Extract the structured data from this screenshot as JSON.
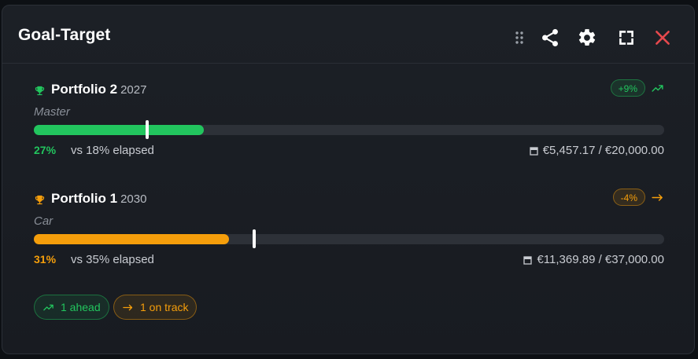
{
  "header": {
    "title": "Goal-Target",
    "icons": [
      "drag-handle-icon",
      "share-icon",
      "gear-icon",
      "fullscreen-icon",
      "close-icon"
    ]
  },
  "colors": {
    "green": "#22c55e",
    "orange": "#f59e0b",
    "red": "#e5484d"
  },
  "goals": [
    {
      "name": "Portfolio 2",
      "year": "2027",
      "category": "Master",
      "badge": "+9%",
      "trend": "up",
      "progress_percent": 27,
      "elapsed_percent": 18,
      "progress_label": "27%",
      "elapsed_label": "vs 18% elapsed",
      "amounts": "€5,457.17 / €20,000.00"
    },
    {
      "name": "Portfolio 1",
      "year": "2030",
      "category": "Car",
      "badge": "-4%",
      "trend": "flat",
      "progress_percent": 31,
      "elapsed_percent": 35,
      "progress_label": "31%",
      "elapsed_label": "vs 35% elapsed",
      "amounts": "€11,369.89 / €37,000.00"
    }
  ],
  "summary": {
    "ahead": "1 ahead",
    "on_track": "1 on track"
  }
}
